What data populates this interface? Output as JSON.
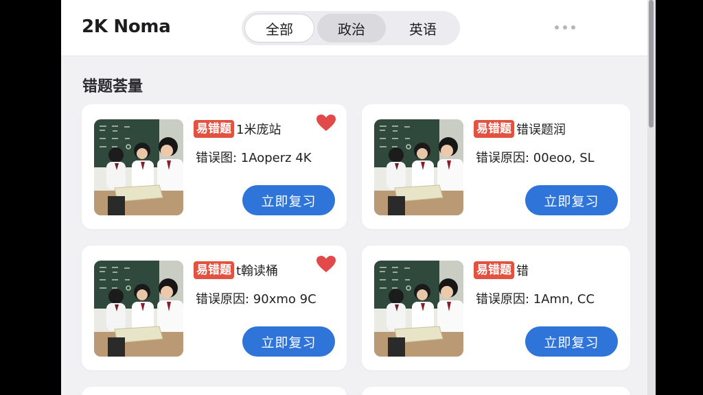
{
  "header": {
    "app_title": "2K Noma",
    "tabs": [
      {
        "label": "全部",
        "state": "selected"
      },
      {
        "label": "政治",
        "state": "highlighted"
      },
      {
        "label": "英语",
        "state": "normal"
      }
    ],
    "more_icon": "more-horizontal-icon"
  },
  "main": {
    "section_title": "错题荟量",
    "cards": [
      {
        "tag": "易错题",
        "topic": "1米庞站",
        "reason": "错误图: 1Aoperz 4K",
        "button": "立即复习",
        "favorited": true
      },
      {
        "tag": "易错题",
        "topic": "错误题润",
        "reason": "错误原因: 00eoo, SL",
        "button": "立即复习",
        "favorited": false
      },
      {
        "tag": "易错题",
        "topic": "t翰读桶",
        "reason": "错误原因: 90xmo 9C",
        "button": "立即复习",
        "favorited": true
      },
      {
        "tag": "易错题",
        "topic": "错",
        "reason": "错误原因: 1Amn, CC",
        "button": "立即复习",
        "favorited": false
      }
    ]
  },
  "colors": {
    "accent": "#2f74d9",
    "tag": "#e25241",
    "heart": "#e24a4a",
    "background": "#f1f1f4"
  },
  "icons": {
    "favorite": "heart-icon",
    "thumbnail": "classroom-photo"
  }
}
